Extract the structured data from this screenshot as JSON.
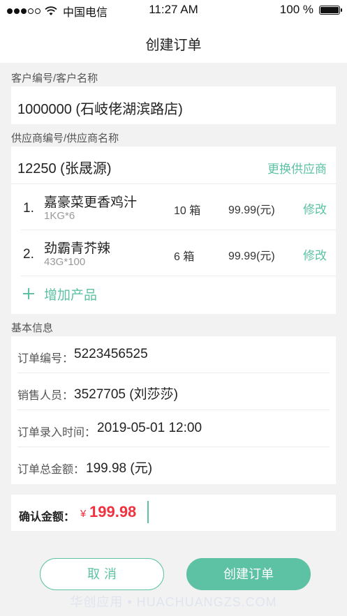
{
  "status_bar": {
    "carrier": "中国电信",
    "time": "11:27 AM",
    "battery": "100 %",
    "signal_bars": 3,
    "battery_level": 1.0
  },
  "nav": {
    "title": "创建订单"
  },
  "customer": {
    "section_label": "客户编号/客户名称",
    "value": "1000000 (石岐佬湖滨路店)"
  },
  "supplier": {
    "section_label": "供应商编号/供应商名称",
    "value": "12250 (张晟源)",
    "switch_label": "更换供应商",
    "products": [
      {
        "index": "1.",
        "name": "嘉豪菜更香鸡汁",
        "spec": "1KG*6",
        "qty": "10 箱",
        "price": "99.99(元)",
        "edit": "修改"
      },
      {
        "index": "2.",
        "name": "劲霸青芥辣",
        "spec": "43G*100",
        "qty": "6 箱",
        "price": "99.99(元)",
        "edit": "修改"
      }
    ],
    "add_label": "增加产品"
  },
  "basic": {
    "section_label": "基本信息",
    "rows": [
      {
        "label": "订单编号：",
        "value": "5223456525"
      },
      {
        "label": "销售人员：",
        "value": "3527705 (刘莎莎)"
      },
      {
        "label": "订单录入时间：",
        "value": "2019-05-01 12:00"
      },
      {
        "label": "订单总金额：",
        "value": "199.98 (元)"
      }
    ]
  },
  "confirm": {
    "label": "确认金额：",
    "currency": "¥",
    "amount": "199.98"
  },
  "actions": {
    "cancel": "取消",
    "create": "创建订单"
  },
  "watermark": "华创应用 • HUACHUANGZS.COM",
  "colors": {
    "accent": "#5dc2a4",
    "amount": "#f0313f",
    "background": "#f2f2f2"
  }
}
